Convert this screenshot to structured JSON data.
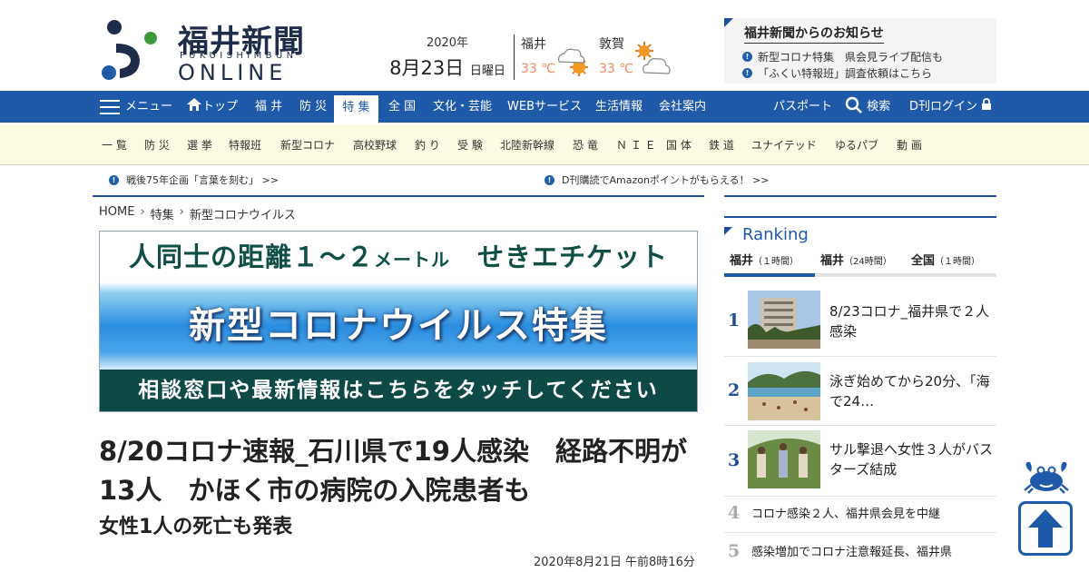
{
  "brand": {
    "title": "福井新聞",
    "sub": "FUKUISHIMBUN",
    "online": "ONLINE",
    "colors": {
      "primary": "#1e5aa8",
      "dark": "#1f2d4a",
      "green": "#3c9a3a"
    }
  },
  "date": {
    "year": "2020年",
    "day": "8月23日",
    "weekday": "日曜日"
  },
  "weather": [
    {
      "city": "福井",
      "temp": "33 ℃",
      "icon": "cloud-sun-icon"
    },
    {
      "city": "敦賀",
      "temp": "33 ℃",
      "icon": "sun-cloud-icon"
    }
  ],
  "notice": {
    "title": "福井新聞からのお知らせ",
    "items": [
      "新型コロナ特集　県会見ライブ配信も",
      "「ふくい特報班」調査依頼はこちら"
    ]
  },
  "nav": {
    "menu_label": "メニュー",
    "items": [
      "トップ",
      "福 井",
      "防 災",
      "特 集",
      "全 国",
      "文化・芸能",
      "WEBサービス",
      "生活情報",
      "会社案内"
    ],
    "active": "特 集",
    "right": [
      "パスポート",
      "検索",
      "D刊ログイン"
    ]
  },
  "subnav": [
    "一 覧",
    "防 災",
    "選 挙",
    "特報班",
    "新型コロナ",
    "高校野球",
    "釣 り",
    "受 験",
    "北陸新幹線",
    "恐 竜",
    "Ｎ Ｉ Ｅ",
    "国 体",
    "鉄 道",
    "ユナイテッド",
    "ゆるパブ",
    "動 画"
  ],
  "tickers": [
    "戦後75年企画「言葉を刻む」 >>",
    "D刊購読でAmazonポイントがもらえる！ >>"
  ],
  "breadcrumb": [
    "HOME",
    "特集",
    "新型コロナウイルス"
  ],
  "banner": {
    "top_a": "人同士の距離１～２",
    "top_b": "メートル",
    "top_c": "せきエチケット",
    "mid": "新型コロナウイルス特集",
    "bot": "相談窓口や最新情報はこちらをタッチしてください"
  },
  "article": {
    "headline_1": "8/20コロナ速報_石川県で19人感染　経路不明が",
    "headline_2": "13人　かほく市の病院の入院患者も",
    "subhead": "女性1人の死亡も発表",
    "pubdate": "2020年8月21日 午前8時16分"
  },
  "ranking": {
    "title": "Ranking",
    "tabs": [
      {
        "name": "福井",
        "span": "（１時間）"
      },
      {
        "name": "福井",
        "span": "（24時間）"
      },
      {
        "name": "全国",
        "span": "（１時間）"
      }
    ],
    "items": [
      {
        "rank": "1",
        "text": "8/23コロナ_福井県で２人感染"
      },
      {
        "rank": "2",
        "text": "泳ぎ始めてから20分、「海で24…"
      },
      {
        "rank": "3",
        "text": "サル撃退へ女性３人がバスターズ結成"
      },
      {
        "rank": "4",
        "text": "コロナ感染２人、福井県会見を中継"
      },
      {
        "rank": "5",
        "text": "感染増加でコロナ注意報延長、福井県"
      }
    ]
  }
}
